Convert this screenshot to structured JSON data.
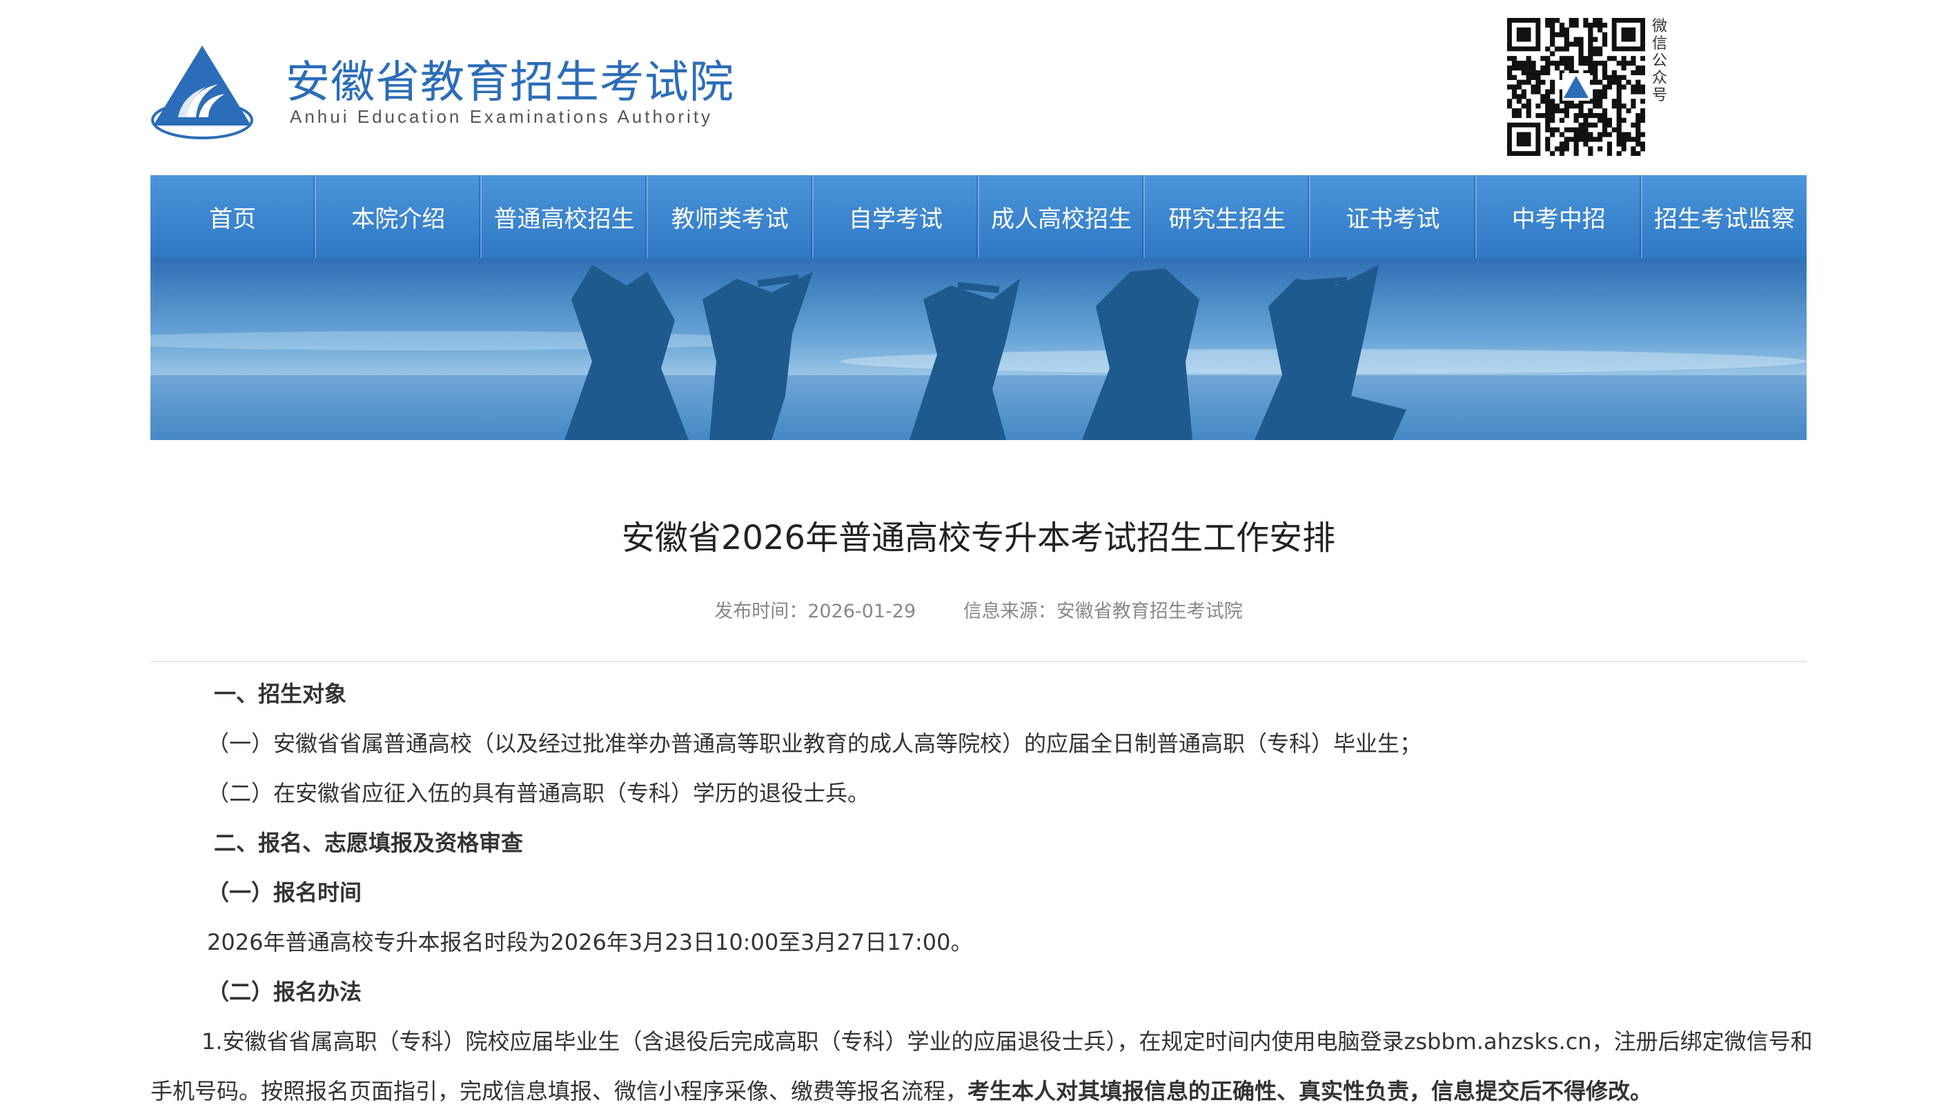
{
  "header": {
    "org_name_cn": "安徽省教育招生考试院",
    "org_name_en": "Anhui Education Examinations Authority",
    "qr_label": "微信公众号"
  },
  "nav": {
    "items": [
      "首页",
      "本院介绍",
      "普通高校招生",
      "教师类考试",
      "自学考试",
      "成人高校招生",
      "研究生招生",
      "证书考试",
      "中考中招",
      "招生考试监察"
    ]
  },
  "article": {
    "title": "安徽省2026年普通高校专升本考试招生工作安排",
    "publish_time": "发布时间：2026-01-29",
    "source": "信息来源：安徽省教育招生考试院",
    "paragraphs": [
      "一、招生对象",
      "（一）安徽省省属普通高校（以及经过批准举办普通高等职业教育的成人高等院校）的应届全日制普通高职（专科）毕业生；",
      "（二）在安徽省应征入伍的具有普通高职（专科）学历的退役士兵。",
      "二、报名、志愿填报及资格审查",
      "（一）报名时间",
      "2026年普通高校专升本报名时段为2026年3月23日10:00至3月27日17:00。",
      "（二）报名办法",
      "1.安徽省省属高职（专科）院校应届毕业生（含退役后完成高职（专科）学业的应届退役士兵），在规定时间内使用电脑登录zsbbm.ahzsks.cn，注册后绑定微信号和",
      "手机号码。按照报名页面指引，完成信息填报、微信小程序采像、缴费等报名流程，",
      "考生本人对其填报信息的正确性、真实性负责，信息提交后不得修改。"
    ]
  },
  "colors": {
    "brand_blue": "#2b6db8",
    "nav_blue": "#3a84cf",
    "text": "#333333",
    "meta": "#888888"
  }
}
